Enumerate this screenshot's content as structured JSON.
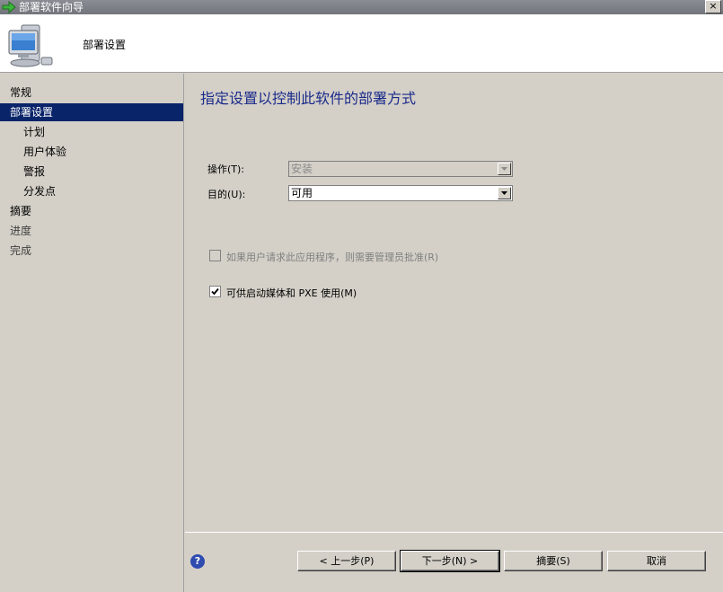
{
  "window": {
    "title": "部署软件向导",
    "close_label": "×"
  },
  "header": {
    "title": "部署设置"
  },
  "sidebar": {
    "items": [
      {
        "label": "常规"
      },
      {
        "label": "部署设置"
      },
      {
        "label": "计划"
      },
      {
        "label": "用户体验"
      },
      {
        "label": "警报"
      },
      {
        "label": "分发点"
      },
      {
        "label": "摘要"
      },
      {
        "label": "进度"
      },
      {
        "label": "完成"
      }
    ]
  },
  "main": {
    "heading": "指定设置以控制此软件的部署方式",
    "action_label": "操作(T):",
    "action_value": "安装",
    "purpose_label": "目的(U):",
    "purpose_value": "可用",
    "require_approval_label": "如果用户请求此应用程序，则需要管理员批准(R)",
    "require_approval_checked": false,
    "boot_media_label": "可供启动媒体和 PXE 使用(M)",
    "boot_media_checked": true
  },
  "footer": {
    "help_symbol": "?",
    "prev_label": "< 上一步(P)",
    "next_label": "下一步(N) >",
    "summary_label": "摘要(S)",
    "cancel_label": "取消"
  },
  "colors": {
    "selection": "#0a246a",
    "heading": "#1a2a8a",
    "face": "#d4d0c8"
  }
}
